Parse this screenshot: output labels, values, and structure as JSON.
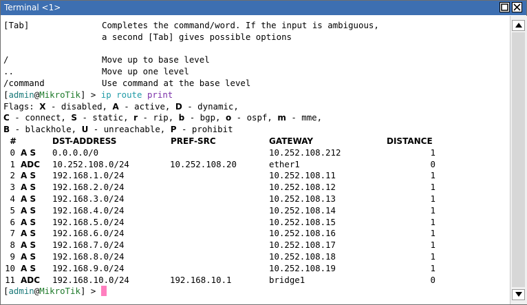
{
  "window": {
    "title": "Terminal <1>",
    "maximize_icon": "maximize-icon",
    "close_icon": "close-icon"
  },
  "colors": {
    "titlebar": "#3d6fb1",
    "user": "#1a7a7a",
    "host": "#1e7a2a",
    "command": "#1f9aa6",
    "argument": "#7a2fa8",
    "cursor": "#ff7fbf"
  },
  "help": [
    {
      "key": "[Tab]",
      "desc": "Completes the command/word. If the input is ambiguous,"
    },
    {
      "key": "",
      "desc": "a second [Tab] gives possible options"
    },
    {
      "key": "",
      "desc": ""
    },
    {
      "key": "/",
      "desc": "Move up to base level"
    },
    {
      "key": "..",
      "desc": "Move up one level"
    },
    {
      "key": "/command",
      "desc": "Use command at the base level"
    }
  ],
  "prompt": {
    "open": "[",
    "user": "admin",
    "at": "@",
    "host": "MikroTik",
    "close": "]",
    "arrow": " > "
  },
  "command": {
    "path": "ip route",
    "action": "print"
  },
  "flags": [
    [
      {
        "text": "Flags: "
      },
      {
        "text": "X",
        "bold": true
      },
      {
        "text": " - disabled, "
      },
      {
        "text": "A",
        "bold": true
      },
      {
        "text": " - active, "
      },
      {
        "text": "D",
        "bold": true
      },
      {
        "text": " - dynamic,"
      }
    ],
    [
      {
        "text": "C",
        "bold": true
      },
      {
        "text": " - connect, "
      },
      {
        "text": "S",
        "bold": true
      },
      {
        "text": " - static, "
      },
      {
        "text": "r",
        "bold": true
      },
      {
        "text": " - rip, "
      },
      {
        "text": "b",
        "bold": true
      },
      {
        "text": " - bgp, "
      },
      {
        "text": "o",
        "bold": true
      },
      {
        "text": " - ospf, "
      },
      {
        "text": "m",
        "bold": true
      },
      {
        "text": " - mme,"
      }
    ],
    [
      {
        "text": "B",
        "bold": true
      },
      {
        "text": " - blackhole, "
      },
      {
        "text": "U",
        "bold": true
      },
      {
        "text": " - unreachable, "
      },
      {
        "text": "P",
        "bold": true
      },
      {
        "text": " - prohibit"
      }
    ]
  ],
  "table": {
    "headers": {
      "num": "#",
      "dst": "DST-ADDRESS",
      "pref": "PREF-SRC",
      "gw": "GATEWAY",
      "dist": "DISTANCE"
    },
    "rows": [
      {
        "num": "0",
        "flags": "A S",
        "dst": "0.0.0.0/0",
        "pref": "",
        "gw": "10.252.108.212",
        "dist": "1"
      },
      {
        "num": "1",
        "flags": "ADC",
        "dst": "10.252.108.0/24",
        "pref": "10.252.108.20",
        "gw": "ether1",
        "dist": "0"
      },
      {
        "num": "2",
        "flags": "A S",
        "dst": "192.168.1.0/24",
        "pref": "",
        "gw": "10.252.108.11",
        "dist": "1"
      },
      {
        "num": "3",
        "flags": "A S",
        "dst": "192.168.2.0/24",
        "pref": "",
        "gw": "10.252.108.12",
        "dist": "1"
      },
      {
        "num": "4",
        "flags": "A S",
        "dst": "192.168.3.0/24",
        "pref": "",
        "gw": "10.252.108.13",
        "dist": "1"
      },
      {
        "num": "5",
        "flags": "A S",
        "dst": "192.168.4.0/24",
        "pref": "",
        "gw": "10.252.108.14",
        "dist": "1"
      },
      {
        "num": "6",
        "flags": "A S",
        "dst": "192.168.5.0/24",
        "pref": "",
        "gw": "10.252.108.15",
        "dist": "1"
      },
      {
        "num": "7",
        "flags": "A S",
        "dst": "192.168.6.0/24",
        "pref": "",
        "gw": "10.252.108.16",
        "dist": "1"
      },
      {
        "num": "8",
        "flags": "A S",
        "dst": "192.168.7.0/24",
        "pref": "",
        "gw": "10.252.108.17",
        "dist": "1"
      },
      {
        "num": "9",
        "flags": "A S",
        "dst": "192.168.8.0/24",
        "pref": "",
        "gw": "10.252.108.18",
        "dist": "1"
      },
      {
        "num": "10",
        "flags": "A S",
        "dst": "192.168.9.0/24",
        "pref": "",
        "gw": "10.252.108.19",
        "dist": "1"
      },
      {
        "num": "11",
        "flags": "ADC",
        "dst": "192.168.10.0/24",
        "pref": "192.168.10.1",
        "gw": "bridge1",
        "dist": "0"
      }
    ]
  },
  "scrollbar": {
    "up_icon": "arrow-up-icon",
    "down_icon": "arrow-down-icon"
  }
}
